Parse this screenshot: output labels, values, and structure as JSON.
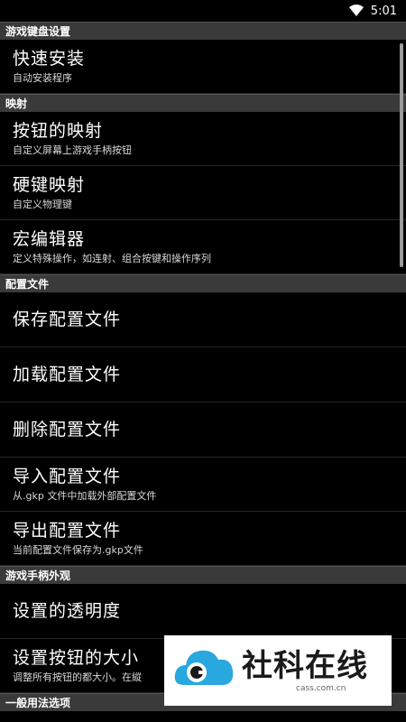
{
  "status_bar": {
    "time": "5:01"
  },
  "sections": [
    {
      "header": "游戏键盘设置",
      "items": [
        {
          "title": "快速安装",
          "subtitle": "自动安装程序"
        }
      ]
    },
    {
      "header": "映射",
      "items": [
        {
          "title": "按钮的映射",
          "subtitle": "自定义屏幕上游戏手柄按钮"
        },
        {
          "title": "硬键映射",
          "subtitle": "自定义物理键"
        },
        {
          "title": "宏编辑器",
          "subtitle": "定义特殊操作，如连射、组合按键和操作序列"
        }
      ]
    },
    {
      "header": "配置文件",
      "items": [
        {
          "title": "保存配置文件",
          "subtitle": ""
        },
        {
          "title": "加载配置文件",
          "subtitle": ""
        },
        {
          "title": "删除配置文件",
          "subtitle": ""
        },
        {
          "title": "导入配置文件",
          "subtitle": "从.gkp 文件中加载外部配置文件"
        },
        {
          "title": "导出配置文件",
          "subtitle": "当前配置文件保存为.gkp文件"
        }
      ]
    },
    {
      "header": "游戏手柄外观",
      "items": [
        {
          "title": "设置的透明度",
          "subtitle": ""
        },
        {
          "title": "设置按钮的大小",
          "subtitle": "调整所有按钮的都大小。在縱"
        }
      ]
    },
    {
      "header": "一般用法选项",
      "items": []
    }
  ],
  "watermark": {
    "title": "社科在线",
    "url": "cass.com.cn"
  }
}
